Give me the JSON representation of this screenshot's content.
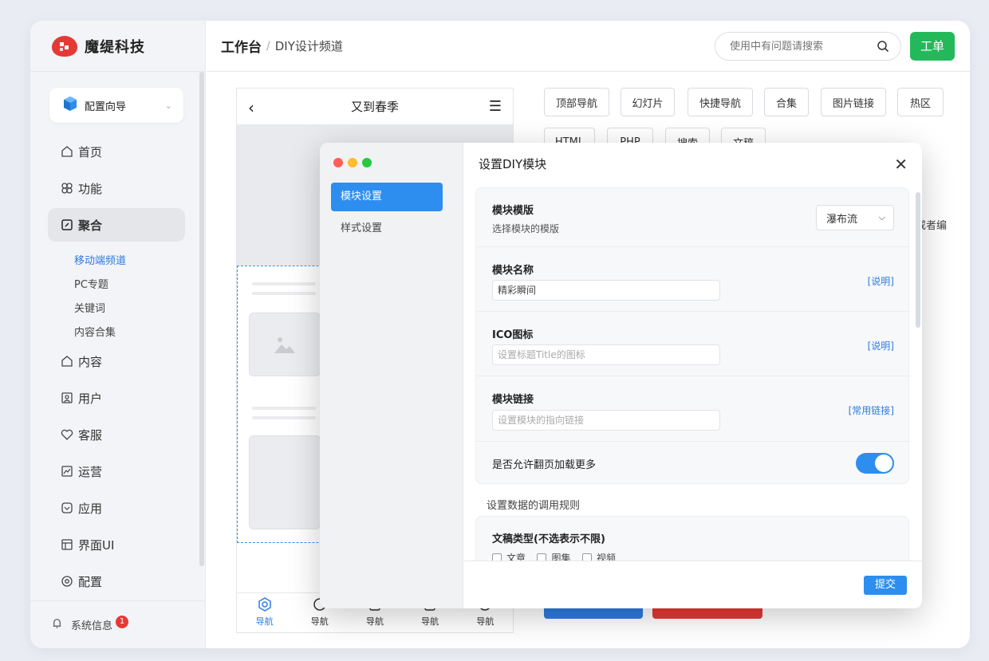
{
  "brand": {
    "name": "魔缇科技",
    "colors": {
      "red": "#e53935"
    }
  },
  "wizard": {
    "label": "配置向导",
    "icon": "cube-icon"
  },
  "sidebar": {
    "items": [
      {
        "label": "首页",
        "icon": "home-icon"
      },
      {
        "label": "功能",
        "icon": "clover-icon"
      },
      {
        "label": "聚合",
        "icon": "compass-icon"
      },
      {
        "label": "内容",
        "icon": "home-icon"
      },
      {
        "label": "用户",
        "icon": "user-card-icon"
      },
      {
        "label": "客服",
        "icon": "heart-icon"
      },
      {
        "label": "运营",
        "icon": "chart-icon"
      },
      {
        "label": "应用",
        "icon": "app-icon"
      },
      {
        "label": "界面UI",
        "icon": "layout-icon"
      },
      {
        "label": "配置",
        "icon": "gear-icon"
      }
    ],
    "sub_items": [
      "移动端频道",
      "PC专题",
      "关键词",
      "内容合集"
    ],
    "sysinfo": {
      "label": "系统信息",
      "badge": "1"
    }
  },
  "topbar": {
    "crumb_root": "工作台",
    "crumb_sep": "/",
    "crumb_current": "DIY设计频道",
    "search_placeholder": "使用中有问题请搜索",
    "work_button": "工单"
  },
  "phone": {
    "title": "又到春季",
    "footer": [
      "导航",
      "导航",
      "导航",
      "导航",
      "导航"
    ]
  },
  "module_tags": [
    "顶部导航",
    "幻灯片",
    "快捷导航",
    "合集",
    "图片链接",
    "热区",
    "HTML",
    "PHP",
    "搜索",
    "文稿"
  ],
  "background_text": {
    "right_edge": "或者编"
  },
  "dialog": {
    "title": "设置DIY模块",
    "tabs": [
      "模块设置",
      "样式设置"
    ],
    "template": {
      "label": "模块模版",
      "sub": "选择模块的模版",
      "value": "瀑布流"
    },
    "name": {
      "label": "模块名称",
      "value": "精彩瞬间",
      "link": "[说明]"
    },
    "ico": {
      "label": "ICO图标",
      "placeholder": "设置标题Title的图标",
      "link": "[说明]"
    },
    "url": {
      "label": "模块链接",
      "placeholder": "设置模块的指向链接",
      "link": "[常用链接]"
    },
    "paging": {
      "label": "是否允许翻页加载更多",
      "on": true
    },
    "rules_title": "设置数据的调用规则",
    "doc_type": {
      "label": "文稿类型(不选表示不限)",
      "options": [
        "文章",
        "图集",
        "视频"
      ]
    },
    "submit": "提交"
  }
}
